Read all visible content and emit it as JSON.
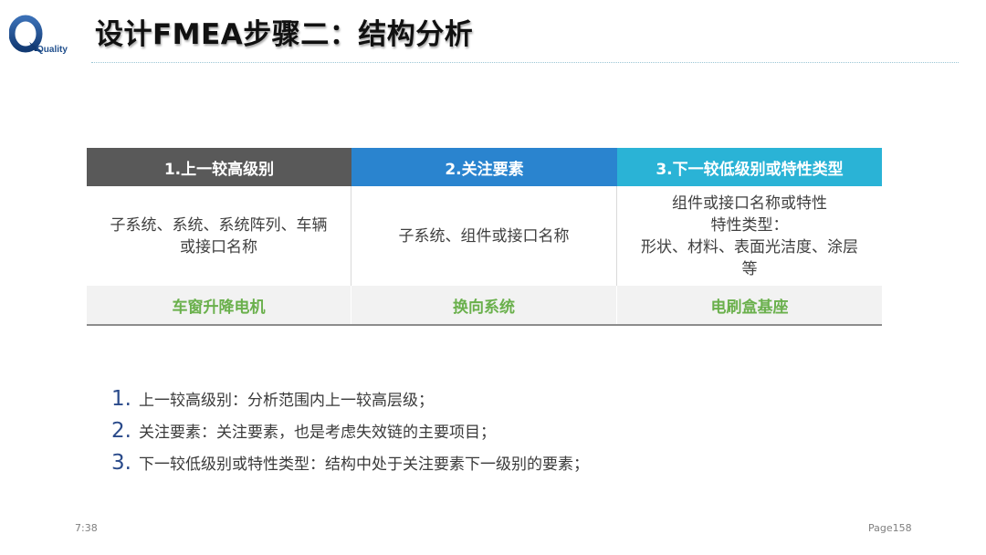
{
  "logo": {
    "text": "Quality"
  },
  "title": "设计FMEA步骤二：结构分析",
  "table": {
    "headers": [
      "1.上一较高级别",
      "2.关注要素",
      "3.下一较低级别或特性类型"
    ],
    "descriptions": [
      [
        "子系统、系统、系统阵列、车辆",
        "或接口名称"
      ],
      [
        "子系统、组件或接口名称"
      ],
      [
        "组件或接口名称或特性",
        "特性类型：",
        "形状、材料、表面光洁度、涂层",
        "等"
      ]
    ],
    "examples": [
      "车窗升降电机",
      "换向系统",
      "电刷盒基座"
    ]
  },
  "notes": [
    {
      "num": "1.",
      "text": "上一较高级别：分析范围内上一较高层级；"
    },
    {
      "num": "2.",
      "text": "关注要素：关注要素，也是考虑失效链的主要项目；"
    },
    {
      "num": "3.",
      "text": "下一较低级别或特性类型：结构中处于关注要素下一级别的要素；"
    }
  ],
  "footer": {
    "time": "7:38",
    "page": "Page158"
  },
  "colors": {
    "header_col1": "#595959",
    "header_col2": "#2a84cf",
    "header_col3": "#2ab3d6",
    "example_text": "#6ab04c",
    "logo_blue": "#1f4e8c"
  }
}
